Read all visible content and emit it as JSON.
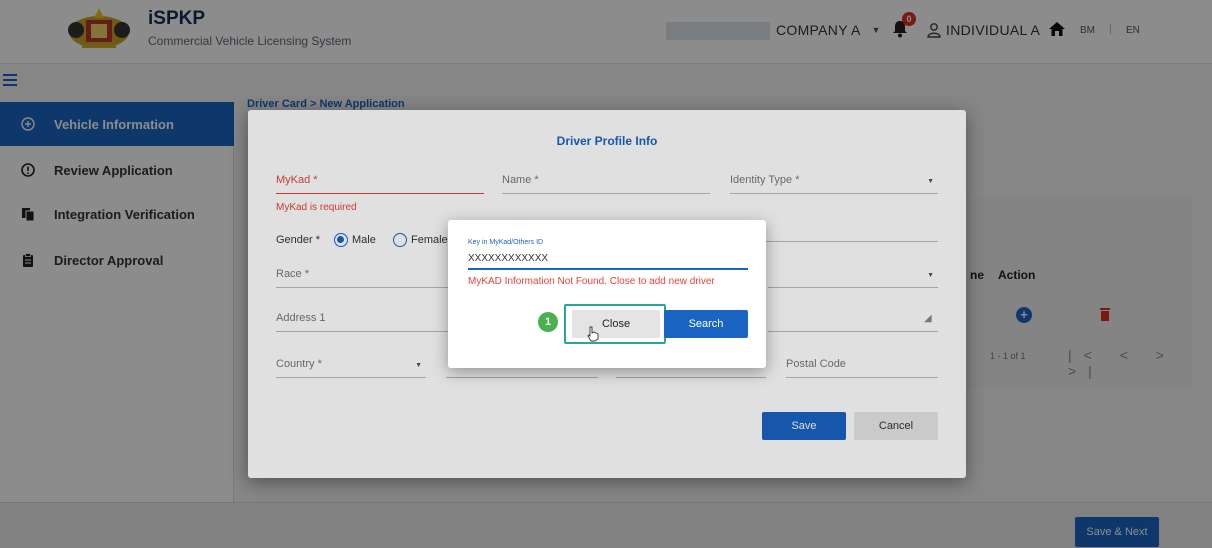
{
  "header": {
    "app_title": "iSPKP",
    "app_subtitle": "Commercial Vehicle Licensing System",
    "company": "COMPANY A",
    "notification_count": "0",
    "user": "INDIVIDUAL A",
    "lang_bm": "BM",
    "lang_separator": "|",
    "lang_en": "EN"
  },
  "sidebar": {
    "items": [
      {
        "label": "Vehicle Information",
        "icon": "add-circle-icon"
      },
      {
        "label": "Review Application",
        "icon": "exclamation-circle-icon"
      },
      {
        "label": "Integration Verification",
        "icon": "documents-icon"
      },
      {
        "label": "Director Approval",
        "icon": "clipboard-icon"
      }
    ]
  },
  "breadcrumb": "Driver Card > New Application",
  "table": {
    "col_name_fragment": "ne",
    "col_action": "Action",
    "pager_range": "1 - 1 of 1",
    "pager_controls": "|< < > >|"
  },
  "footer": {
    "save_next_label": "Save & Next"
  },
  "profile_dialog": {
    "title": "Driver Profile Info",
    "mykad_label": "MyKad *",
    "mykad_error": "MyKad is required",
    "name_label": "Name *",
    "identity_type_label": "Identity Type *",
    "gender_label": "Gender *",
    "gender_male": "Male",
    "gender_female": "Female",
    "race_label": "Race *",
    "address1_label": "Address 1",
    "country_label": "Country *",
    "postal_code_label": "Postal Code",
    "save_label": "Save",
    "cancel_label": "Cancel"
  },
  "search_popup": {
    "input_label": "Key in MyKad/Others ID",
    "input_value": "XXXXXXXXXXXX",
    "message": "MyKAD Information Not Found. Close to add new driver",
    "step_number": "1",
    "close_label": "Close",
    "search_label": "Search"
  },
  "colors": {
    "primary": "#1a64c4",
    "error": "#e0453a",
    "step_badge": "#4caf50",
    "highlight": "#2aa59a"
  }
}
